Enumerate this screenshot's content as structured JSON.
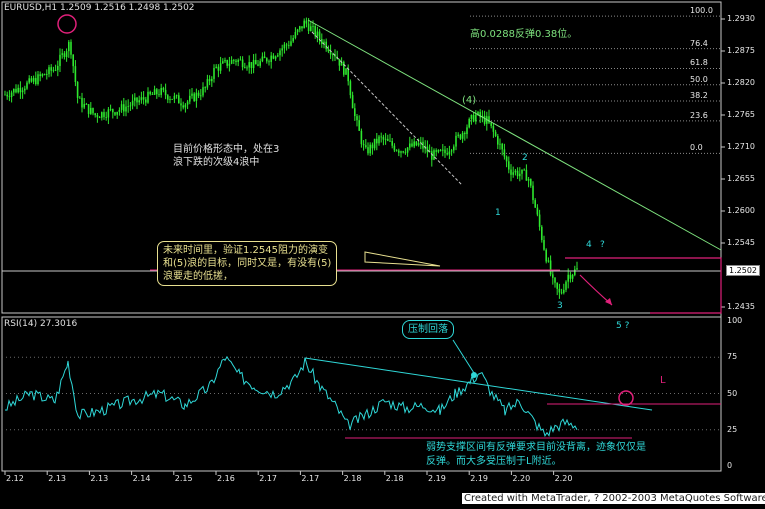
{
  "main_chart": {
    "symbol_info": "EURUSD,H1  1.2509 1.2516 1.2498 1.2502",
    "current_price": "1.2502",
    "price_axis": [
      {
        "label": "1.2930",
        "value": 1.293
      },
      {
        "label": "1.2875",
        "value": 1.2875
      },
      {
        "label": "1.2820",
        "value": 1.282
      },
      {
        "label": "1.2765",
        "value": 1.2765
      },
      {
        "label": "1.2710",
        "value": 1.271
      },
      {
        "label": "1.2655",
        "value": 1.2655
      },
      {
        "label": "1.2600",
        "value": 1.26
      },
      {
        "label": "1.2545",
        "value": 1.2545
      },
      {
        "label": "1.2435",
        "value": 1.2435
      }
    ],
    "fib_levels": [
      {
        "label": "100.0",
        "value": 1.2935
      },
      {
        "label": "76.4",
        "value": 1.2879
      },
      {
        "label": "61.8",
        "value": 1.2845
      },
      {
        "label": "50.0",
        "value": 1.2817
      },
      {
        "label": "38.2",
        "value": 1.2789
      },
      {
        "label": "23.6",
        "value": 1.2755
      },
      {
        "label": "0.0",
        "value": 1.2699
      }
    ],
    "wave_labels": [
      {
        "text": "(4)",
        "color": "#7ee27e"
      },
      {
        "text": "1",
        "color": "#2fd8d8"
      },
      {
        "text": "2",
        "color": "#2fd8d8"
      },
      {
        "text": "3",
        "color": "#2fd8d8"
      },
      {
        "text": "4",
        "color": "#2fd8d8"
      },
      {
        "text": "?",
        "color": "#2fd8d8"
      },
      {
        "text": "5 ?",
        "color": "#2fd8d8"
      }
    ],
    "annotation_top": "高0.0288反弹0.38位。",
    "annotation_left": [
      "目前价格形态中，处在3",
      "浪下跌的次级4浪中"
    ],
    "callout_lines": [
      "未来时间里，验证1.2545阻力的演变",
      "和(5)浪的目标，同时又是，有没有(5)",
      "浪要走的低搓，"
    ]
  },
  "rsi_chart": {
    "title": "RSI(14)  27.3016",
    "axis": [
      {
        "label": "100",
        "value": 100
      },
      {
        "label": "75",
        "value": 75
      },
      {
        "label": "50",
        "value": 50
      },
      {
        "label": "25",
        "value": 25
      },
      {
        "label": "0",
        "value": 0
      }
    ],
    "callout": "压制回落",
    "marker_label": "L",
    "annotation_lines": [
      "弱势支撑区间有反弹要求目前没背离，迹象仅仅是",
      "反弹。而大多受压制于L附近。"
    ]
  },
  "time_axis": [
    "2.12",
    "2.13",
    "2.13",
    "2.14",
    "2.15",
    "2.16",
    "2.17",
    "2.17",
    "2.18",
    "2.18",
    "2.19",
    "2.19",
    "2.20",
    "2.20"
  ],
  "footer": "Created with MetaTrader, ? 2002-2003 MetaQuotes Software Corp.",
  "colors": {
    "candles": "#2ee82e",
    "trendline": "#7ee27e",
    "rsi": "#2fd8d8",
    "magenta": "#e0207a",
    "callout": "#e8e090"
  }
}
